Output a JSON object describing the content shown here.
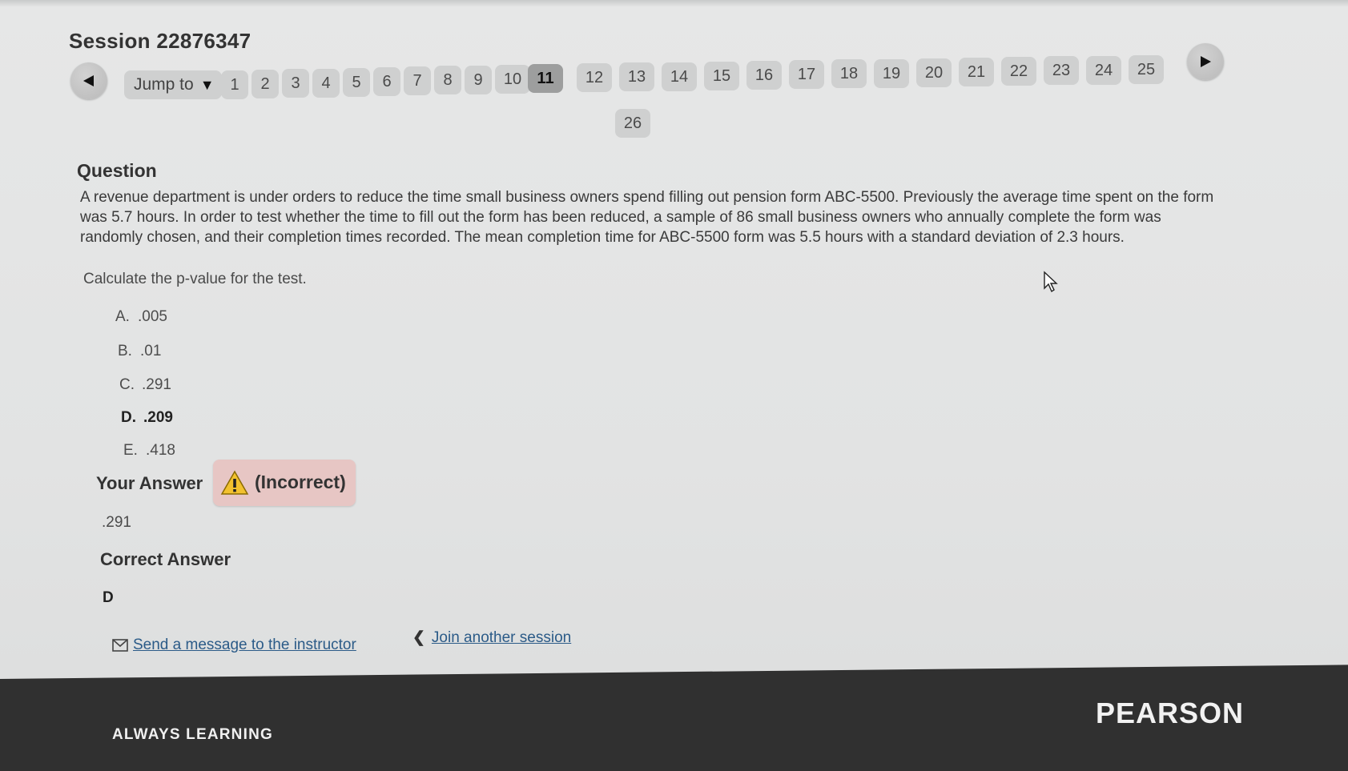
{
  "session": {
    "title": "Session 22876347"
  },
  "pager": {
    "jump_label": "Jump to",
    "current_page": "11",
    "pages": [
      "1",
      "2",
      "3",
      "4",
      "5",
      "6",
      "7",
      "8",
      "9",
      "10",
      "11",
      "12",
      "13",
      "14",
      "15",
      "16",
      "17",
      "18",
      "19",
      "20",
      "21",
      "22",
      "23",
      "24",
      "25",
      "26"
    ]
  },
  "question": {
    "heading": "Question",
    "text": "A revenue department is under orders to reduce the time small business owners spend filling out pension form ABC-5500. Previously the average time spent on the form was 5.7 hours. In order to test whether the time to fill out the form has been reduced, a sample of 86 small business owners who annually complete the form was randomly chosen, and their completion times recorded. The mean completion time for ABC-5500 form was 5.5 hours with a standard deviation of 2.3 hours.",
    "instruction": "Calculate the p-value for the test.",
    "options": [
      {
        "letter": "A.",
        "value": ".005"
      },
      {
        "letter": "B.",
        "value": ".01"
      },
      {
        "letter": "C.",
        "value": ".291"
      },
      {
        "letter": "D.",
        "value": ".209"
      },
      {
        "letter": "E.",
        "value": ".418"
      }
    ]
  },
  "answer": {
    "your_answer_label": "Your Answer",
    "status": "(Incorrect)",
    "your_answer_value": ".291",
    "correct_answer_label": "Correct Answer",
    "correct_answer_value": "D"
  },
  "links": {
    "message": "Send a message to the instructor",
    "join": "Join another session"
  },
  "footer": {
    "tagline": "ALWAYS LEARNING",
    "brand": "PEARSON"
  },
  "colors": {
    "incorrect_badge": "#e7c6c4",
    "current_page": "#9d9e9e",
    "link": "#2b5b88",
    "footer": "#303030"
  },
  "icons": [
    "chevron-left-icon",
    "chevron-right-icon",
    "warning-icon",
    "envelope-icon",
    "chevron-back-icon"
  ]
}
